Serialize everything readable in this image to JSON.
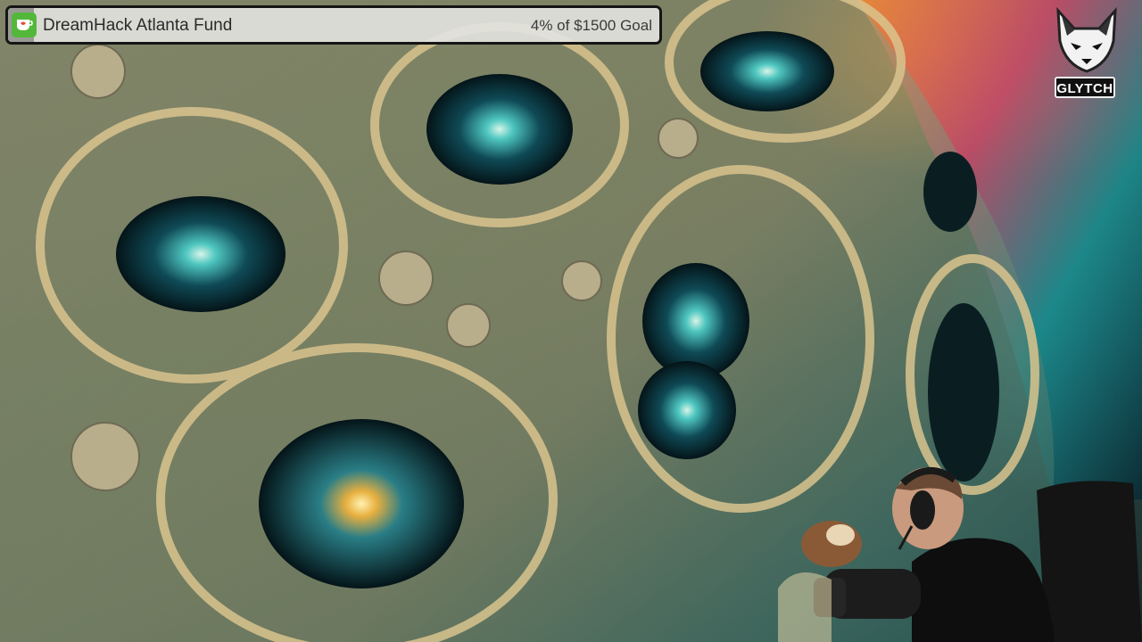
{
  "goal": {
    "title": "DreamHack Atlanta Fund",
    "progress_text": "4% of $1500 Goal",
    "progress_fraction": 0.04,
    "icon": "cup-icon",
    "icon_color": "#53b83a"
  },
  "brand": {
    "label": "GLYTCH",
    "icon": "fox-logo-icon"
  },
  "colors": {
    "bar_background": "#e2e2de",
    "bar_border": "#151515",
    "teal": "#1f8a8e"
  }
}
